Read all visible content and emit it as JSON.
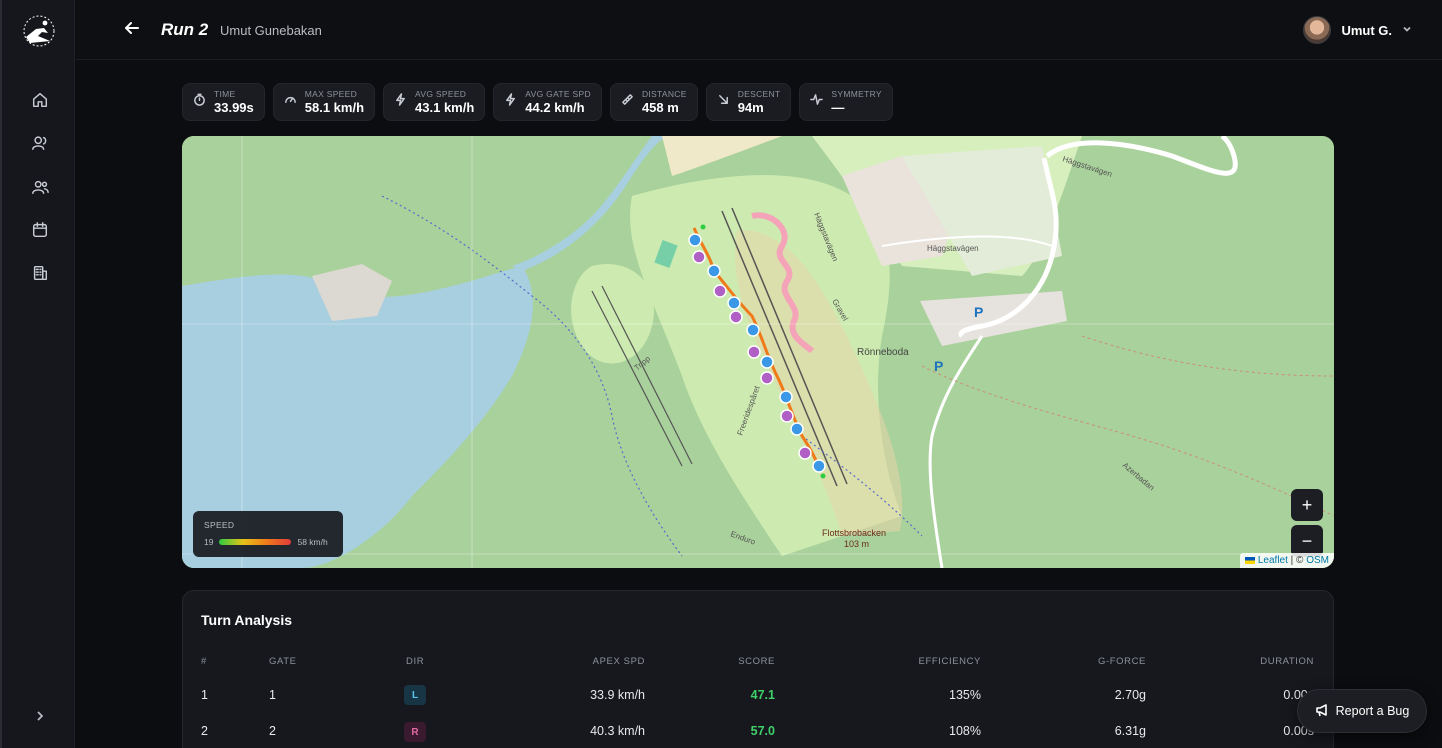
{
  "header": {
    "title": "Run 2",
    "subtitle": "Umut Gunebakan",
    "user_name": "Umut G."
  },
  "sidebar": {
    "items": [
      {
        "icon": "home-icon"
      },
      {
        "icon": "user-icon"
      },
      {
        "icon": "users-icon"
      },
      {
        "icon": "calendar-icon"
      },
      {
        "icon": "building-icon"
      }
    ]
  },
  "stats": [
    {
      "label": "TIME",
      "value": "33.99s",
      "icon": "stopwatch-icon"
    },
    {
      "label": "MAX SPEED",
      "value": "58.1 km/h",
      "icon": "gauge-icon"
    },
    {
      "label": "AVG SPEED",
      "value": "43.1 km/h",
      "icon": "bolt-icon"
    },
    {
      "label": "AVG GATE SPD",
      "value": "44.2 km/h",
      "icon": "bolt-icon"
    },
    {
      "label": "DISTANCE",
      "value": "458 m",
      "icon": "ruler-icon"
    },
    {
      "label": "DESCENT",
      "value": "94m",
      "icon": "arrow-down-right-icon"
    },
    {
      "label": "SYMMETRY",
      "value": "—",
      "icon": "activity-icon"
    }
  ],
  "map": {
    "legend_title": "SPEED",
    "legend_min": "19",
    "legend_max": "58 km/h",
    "zoom_in": "+",
    "zoom_out": "−",
    "attribution_leaflet": "Leaflet",
    "attribution_sep": " | © ",
    "attribution_osm": "OSM",
    "labels": {
      "haggstavagen_top": "Häggstavägen",
      "haggstavagen_mid": "Häggstavägen",
      "ronneboda": "Rönneboda",
      "flottsbrobacken": "Flottsbrobacken",
      "elevation": "103 m",
      "parking": "P",
      "azerbadan": "Azerbadan",
      "enduro": "Enduro",
      "tripp": "Tripp",
      "haggsta_road": "Häggstavägen",
      "gravel": "Gravel",
      "freeride": "Freeridespåret"
    }
  },
  "turn_analysis": {
    "title": "Turn Analysis",
    "columns": [
      "#",
      "GATE",
      "DIR",
      "APEX SPD",
      "SCORE",
      "EFFICIENCY",
      "G-FORCE",
      "DURATION"
    ],
    "rows": [
      {
        "num": "1",
        "gate": "1",
        "dir": "L",
        "apex": "33.9 km/h",
        "score": "47.1",
        "efficiency": "135%",
        "gforce": "2.70g",
        "duration": "0.00s"
      },
      {
        "num": "2",
        "gate": "2",
        "dir": "R",
        "apex": "40.3 km/h",
        "score": "57.0",
        "efficiency": "108%",
        "gforce": "6.31g",
        "duration": "0.00s"
      }
    ]
  },
  "bug_button": "Report a Bug"
}
